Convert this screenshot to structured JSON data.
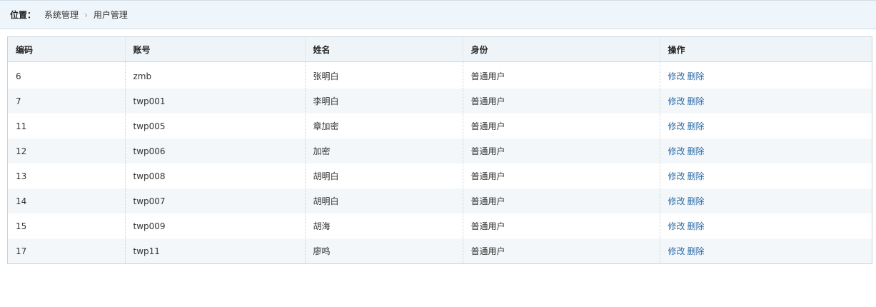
{
  "breadcrumb": {
    "label": "位置：",
    "items": [
      "系统管理",
      "用户管理"
    ]
  },
  "table": {
    "headers": [
      "编码",
      "账号",
      "姓名",
      "身份",
      "操作"
    ],
    "edit_label": "修改",
    "delete_label": "删除",
    "rows": [
      {
        "id": "6",
        "account": "zmb",
        "name": "张明白",
        "role": "普通用户"
      },
      {
        "id": "7",
        "account": "twp001",
        "name": "李明白",
        "role": "普通用户"
      },
      {
        "id": "11",
        "account": "twp005",
        "name": "章加密",
        "role": "普通用户"
      },
      {
        "id": "12",
        "account": "twp006",
        "name": "加密",
        "role": "普通用户"
      },
      {
        "id": "13",
        "account": "twp008",
        "name": "胡明白",
        "role": "普通用户"
      },
      {
        "id": "14",
        "account": "twp007",
        "name": "胡明白",
        "role": "普通用户"
      },
      {
        "id": "15",
        "account": "twp009",
        "name": "胡海",
        "role": "普通用户"
      },
      {
        "id": "17",
        "account": "twp11",
        "name": "廖鸣",
        "role": "普通用户"
      }
    ]
  }
}
